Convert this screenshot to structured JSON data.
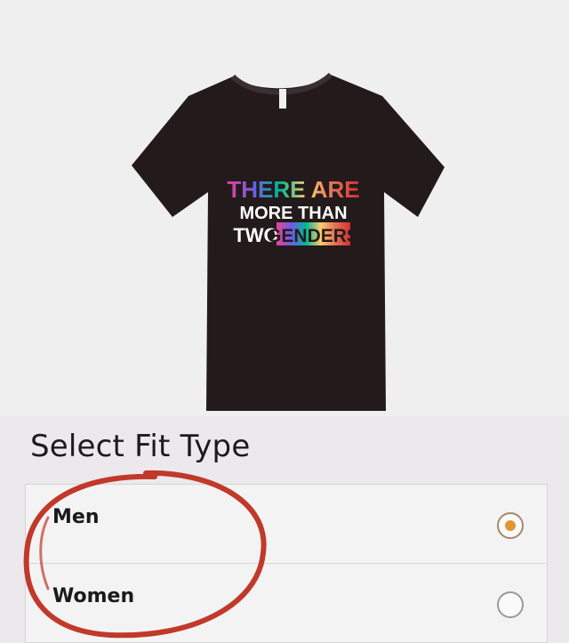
{
  "product": {
    "shirt_print": {
      "line1": "THERE ARE",
      "line2": "MORE THAN",
      "line3_a": "TWO",
      "line3_b": "GENDERS"
    },
    "shirt_color": "#231a1c"
  },
  "fit_selector": {
    "title": "Select Fit Type",
    "options": [
      {
        "label": "Men",
        "selected": true
      },
      {
        "label": "Women",
        "selected": false
      }
    ],
    "accent_color": "#e0962e"
  },
  "annotation": {
    "color": "#c0392b",
    "icon": "hand-drawn-circle"
  }
}
